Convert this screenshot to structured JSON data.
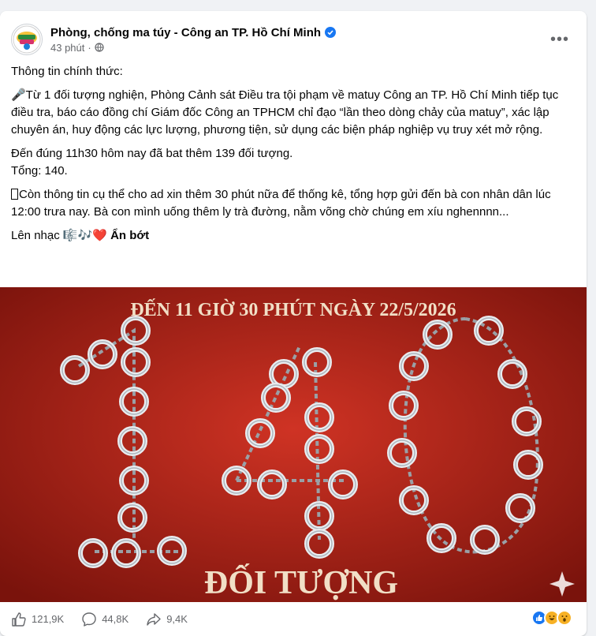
{
  "post": {
    "author": "Phòng, chống ma túy - Công an TP. Hồ Chí Minh",
    "time": "43 phút",
    "separator": "·",
    "paragraphs": [
      "Thông tin chính thức:",
      "🎤Từ 1 đối tượng nghiện, Phòng Cảnh sát Điều tra tội phạm về matuy Công an TP. Hồ Chí Minh tiếp tục điều tra, báo cáo đồng chí Giám đốc Công an TPHCM chỉ đạo “lần theo dòng chảy của matuy”, xác lập chuyên án, huy động các lực lượng, phương tiện, sử dụng các biện pháp nghiệp vụ truy xét mở rộng.",
      "Đến đúng 11h30 hôm nay đã bat thêm 139 đối tượng.\nTổng: 140.",
      "Còn thông tin cụ thể cho ad xin thêm 30 phút nữa để thống kê, tổng hợp gửi đến bà con nhân dân lúc 12:00 trưa nay. Bà con mình uống thêm ly trà đường, nằm võng chờ chúng em xíu nghennnn..."
    ],
    "music_line": "Lên nhạc 🎼🎶❤️",
    "see_less": "Ẩn bớt",
    "poster": {
      "headline": "ĐẾN 11 GIỜ 30 PHÚT NGÀY 22/5/2026",
      "number": "140",
      "caption": "ĐỐI TƯỢNG",
      "bg_color": "#b8281c"
    }
  },
  "footer": {
    "likes": "121,9K",
    "comments": "44,8K",
    "shares": "9,4K"
  }
}
